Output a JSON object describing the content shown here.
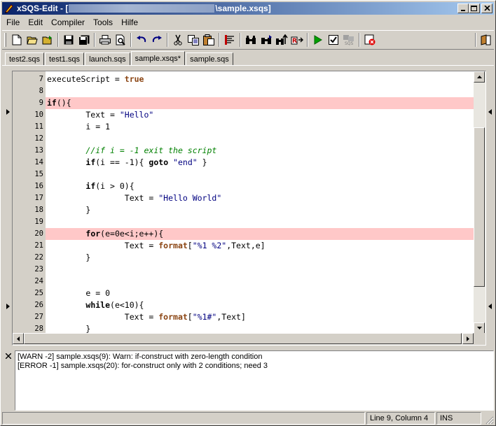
{
  "window": {
    "title_prefix": "xSQS-Edit - [",
    "title_suffix": "\\sample.xsqs]"
  },
  "menu": [
    "File",
    "Edit",
    "Compiler",
    "Tools",
    "Hilfe"
  ],
  "toolbar": {
    "tools": [
      "new-file-icon",
      "open-file-icon",
      "open-folder-icon",
      "save-icon",
      "save-all-icon",
      "print-icon",
      "print-preview-icon",
      "undo-icon",
      "redo-icon",
      "cut-icon",
      "copy-icon",
      "paste-icon",
      "bookmark-icon",
      "find-icon",
      "find-next-icon",
      "find-replace-icon",
      "replace-icon",
      "run-icon",
      "check-icon",
      "compile-icon",
      "stop-icon",
      "exit-icon"
    ]
  },
  "tabs": [
    {
      "label": "test2.sqs",
      "active": false
    },
    {
      "label": "test1.sqs",
      "active": false
    },
    {
      "label": "launch.sqs",
      "active": false
    },
    {
      "label": "sample.xsqs*",
      "active": true
    },
    {
      "label": "sample.sqs",
      "active": false
    }
  ],
  "editor": {
    "highlight_color": "#ffc8c8",
    "lines": [
      {
        "num": "7",
        "hl": false,
        "tokens": [
          [
            "t",
            "executeScript = "
          ],
          [
            "lit",
            "true"
          ]
        ]
      },
      {
        "num": "8",
        "hl": false,
        "tokens": []
      },
      {
        "num": "9",
        "hl": true,
        "tokens": [
          [
            "kw",
            "if"
          ],
          [
            "t",
            "(){"
          ]
        ]
      },
      {
        "num": "10",
        "hl": false,
        "tokens": [
          [
            "t",
            "        Text = "
          ],
          [
            "str",
            "\"Hello\""
          ]
        ]
      },
      {
        "num": "11",
        "hl": false,
        "tokens": [
          [
            "t",
            "        i = 1"
          ]
        ]
      },
      {
        "num": "12",
        "hl": false,
        "tokens": []
      },
      {
        "num": "13",
        "hl": false,
        "tokens": [
          [
            "t",
            "        "
          ],
          [
            "cmt",
            "//if i = -1 exit the script"
          ]
        ]
      },
      {
        "num": "14",
        "hl": false,
        "tokens": [
          [
            "t",
            "        "
          ],
          [
            "kw",
            "if"
          ],
          [
            "t",
            "(i == -1){ "
          ],
          [
            "kw",
            "goto"
          ],
          [
            "t",
            " "
          ],
          [
            "str",
            "\"end\""
          ],
          [
            "t",
            " }"
          ]
        ]
      },
      {
        "num": "15",
        "hl": false,
        "tokens": []
      },
      {
        "num": "16",
        "hl": false,
        "tokens": [
          [
            "t",
            "        "
          ],
          [
            "kw",
            "if"
          ],
          [
            "t",
            "(i > 0){"
          ]
        ]
      },
      {
        "num": "17",
        "hl": false,
        "tokens": [
          [
            "t",
            "                Text = "
          ],
          [
            "str",
            "\"Hello World\""
          ]
        ]
      },
      {
        "num": "18",
        "hl": false,
        "tokens": [
          [
            "t",
            "        }"
          ]
        ]
      },
      {
        "num": "19",
        "hl": false,
        "tokens": []
      },
      {
        "num": "20",
        "hl": true,
        "tokens": [
          [
            "t",
            "        "
          ],
          [
            "kw",
            "for"
          ],
          [
            "t",
            "(e=0e<i;e++){"
          ]
        ]
      },
      {
        "num": "21",
        "hl": false,
        "tokens": [
          [
            "t",
            "                Text = "
          ],
          [
            "fn",
            "format"
          ],
          [
            "t",
            "["
          ],
          [
            "str",
            "\"%1 %2\""
          ],
          [
            "t",
            ",Text,e]"
          ]
        ]
      },
      {
        "num": "22",
        "hl": false,
        "tokens": [
          [
            "t",
            "        }"
          ]
        ]
      },
      {
        "num": "23",
        "hl": false,
        "tokens": []
      },
      {
        "num": "24",
        "hl": false,
        "tokens": []
      },
      {
        "num": "25",
        "hl": false,
        "tokens": [
          [
            "t",
            "        e = 0"
          ]
        ]
      },
      {
        "num": "26",
        "hl": false,
        "tokens": [
          [
            "t",
            "        "
          ],
          [
            "kw",
            "while"
          ],
          [
            "t",
            "(e<10){"
          ]
        ]
      },
      {
        "num": "27",
        "hl": false,
        "tokens": [
          [
            "t",
            "                Text = "
          ],
          [
            "fn",
            "format"
          ],
          [
            "t",
            "["
          ],
          [
            "str",
            "\"%1#\""
          ],
          [
            "t",
            ",Text]"
          ]
        ]
      },
      {
        "num": "28",
        "hl": false,
        "tokens": [
          [
            "t",
            "        }"
          ]
        ]
      }
    ]
  },
  "output": {
    "messages": [
      "[WARN -2] sample.xsqs(9): Warn: if-construct with zero-length condition",
      "[ERROR -1] sample.xsqs(20): for-construct only with 2 conditions; need 3"
    ]
  },
  "status": {
    "position": "Line 9, Column 4",
    "mode": "INS"
  }
}
